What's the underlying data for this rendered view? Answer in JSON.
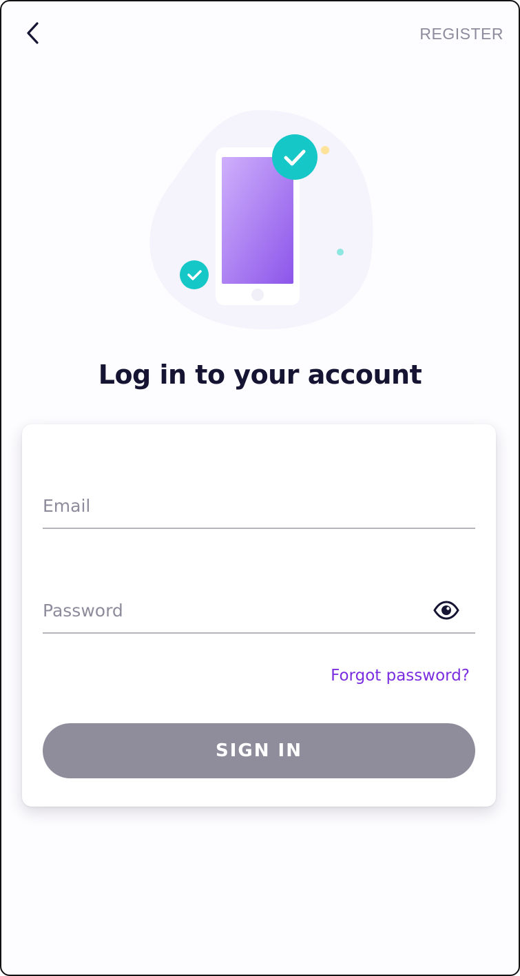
{
  "header": {
    "back_icon": "chevron-left-icon",
    "register_label": "REGISTER"
  },
  "illustration": {
    "phone_icon": "smartphone-icon",
    "check_icon": "check-circle-icon",
    "colors": {
      "blob": "#f5f3fc",
      "phone_frame": "#ffffff",
      "screen_top": "#c9a9fb",
      "screen_bottom": "#9059ec",
      "check_badge": "#15c7c6",
      "dot_yellow": "#fde39a",
      "dot_teal": "#8ee6e0"
    }
  },
  "title": "Log in to your account",
  "form": {
    "email_placeholder": "Email",
    "email_value": "",
    "password_placeholder": "Password",
    "password_value": "",
    "password_toggle_icon": "eye-icon",
    "forgot_label": "Forgot password?",
    "submit_label": "SIGN IN"
  },
  "colors": {
    "accent": "#7b2ee0",
    "button_disabled": "#8f8c9c",
    "title_text": "#161433",
    "muted_text": "#8e8c9c"
  }
}
